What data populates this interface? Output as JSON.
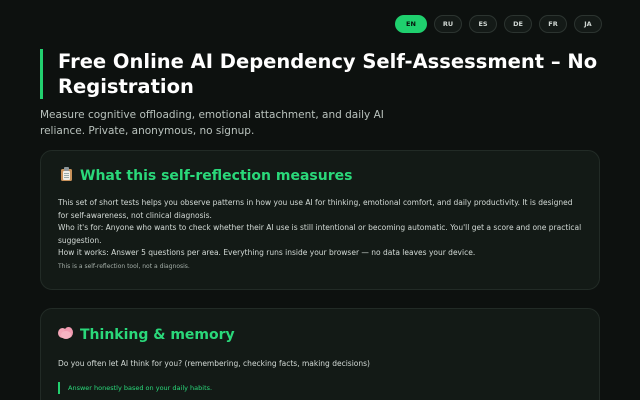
{
  "languages": [
    {
      "code": "EN",
      "active": true
    },
    {
      "code": "RU",
      "active": false
    },
    {
      "code": "ES",
      "active": false
    },
    {
      "code": "DE",
      "active": false
    },
    {
      "code": "FR",
      "active": false
    },
    {
      "code": "JA",
      "active": false
    }
  ],
  "header": {
    "title": "Free Online AI Dependency Self-Assessment – No Registration",
    "subtitle": "Measure cognitive offloading, emotional attachment, and daily AI reliance. Private, anonymous, no signup."
  },
  "intro_card": {
    "icon": "clipboard-icon",
    "title": "What this self-reflection measures",
    "paragraphs": [
      "This set of short tests helps you observe patterns in how you use AI for thinking, emotional comfort, and daily productivity. It is designed for self-awareness, not clinical diagnosis.",
      "Who it's for: Anyone who wants to check whether their AI use is still intentional or becoming automatic. You'll get a score and one practical suggestion.",
      "How it works: Answer 5 questions per area. Everything runs inside your browser — no data leaves your device."
    ],
    "note": "This is a self-reflection tool, not a diagnosis."
  },
  "section_card": {
    "icon": "brain-icon",
    "title": "Thinking & memory",
    "question": "Do you often let AI think for you? (remembering, checking facts, making decisions)",
    "hint": "Answer honestly based on your daily habits."
  },
  "colors": {
    "accent": "#22d06f",
    "background": "#0d110f",
    "card": "#131a16"
  }
}
